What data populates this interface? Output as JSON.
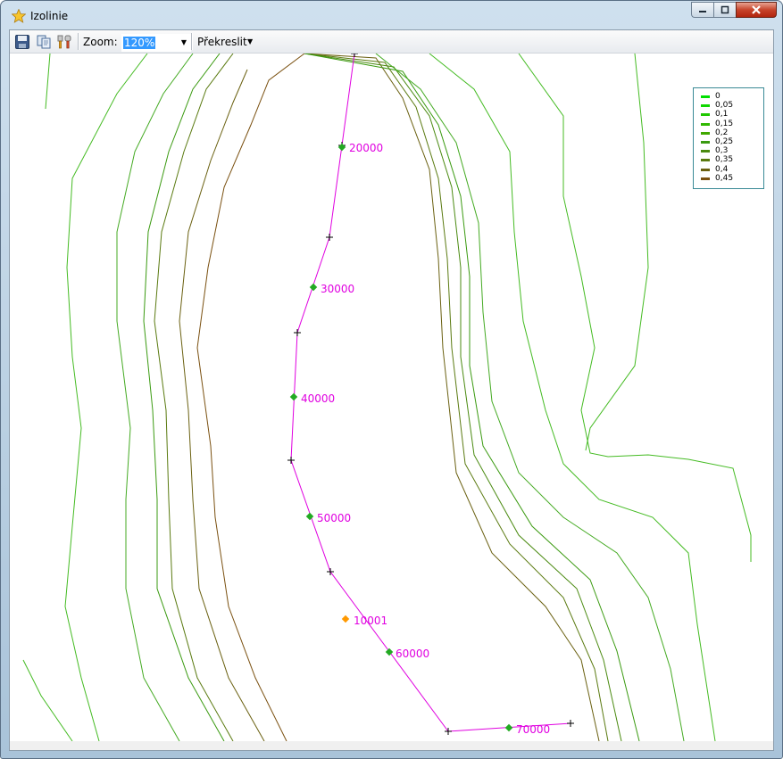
{
  "window": {
    "title": "Izolinie"
  },
  "toolbar": {
    "zoom_label": "Zoom:",
    "zoom_value": "120%",
    "redraw_label": "Překreslit",
    "icons": [
      "save-icon",
      "copy-icon",
      "tools-icon"
    ]
  },
  "legend": {
    "items": [
      {
        "label": "0",
        "color": "#00e000"
      },
      {
        "label": "0,05",
        "color": "#10d800"
      },
      {
        "label": "0,1",
        "color": "#20c800"
      },
      {
        "label": "0,15",
        "color": "#30b800"
      },
      {
        "label": "0,2",
        "color": "#40a800"
      },
      {
        "label": "0,25",
        "color": "#3a9a10"
      },
      {
        "label": "0,3",
        "color": "#4a8a10"
      },
      {
        "label": "0,35",
        "color": "#5a7a10"
      },
      {
        "label": "0,4",
        "color": "#6a6010"
      },
      {
        "label": "0,45",
        "color": "#7a5010"
      }
    ]
  },
  "profile": {
    "color": "#e000e0",
    "points": [
      {
        "label": "20000"
      },
      {
        "label": "30000"
      },
      {
        "label": "40000"
      },
      {
        "label": "50000"
      },
      {
        "label": "10001"
      },
      {
        "label": "60000"
      },
      {
        "label": "70000"
      }
    ]
  },
  "colors": {
    "marker_green": "#22aa22",
    "marker_orange": "#ff9900"
  }
}
